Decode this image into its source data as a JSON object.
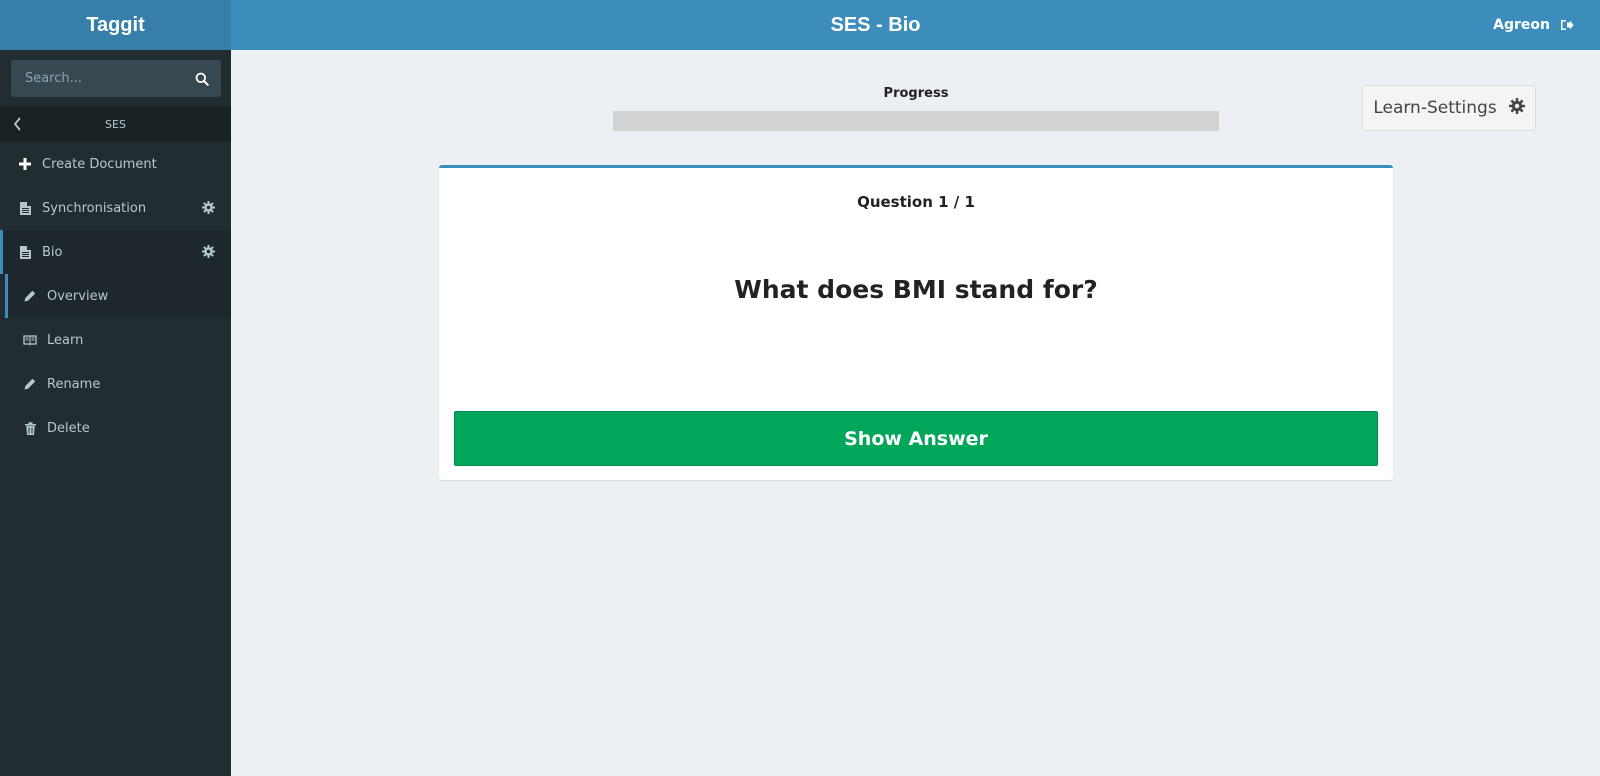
{
  "header": {
    "brand": "Taggit",
    "title": "SES - Bio",
    "user": "Agreon",
    "logout_icon": "sign-out-icon"
  },
  "sidebar": {
    "search_placeholder": "Search...",
    "breadcrumb": "SES",
    "items": [
      {
        "label": "Create Document",
        "icon": "plus-icon"
      },
      {
        "label": "Synchronisation",
        "icon": "document-icon",
        "has_settings": true
      },
      {
        "label": "Bio",
        "icon": "document-icon",
        "has_settings": true,
        "active": true
      }
    ],
    "subitems": [
      {
        "label": "Overview",
        "icon": "pencil-icon",
        "current": true
      },
      {
        "label": "Learn",
        "icon": "book-icon"
      },
      {
        "label": "Rename",
        "icon": "pencil-icon"
      },
      {
        "label": "Delete",
        "icon": "trash-icon"
      }
    ]
  },
  "main": {
    "progress_label": "Progress",
    "progress_value": 0,
    "learn_settings_label": "Learn-Settings",
    "question_counter": "Question 1 / 1",
    "question_text": "What does BMI stand for?",
    "show_answer_label": "Show Answer"
  },
  "colors": {
    "header": "#3c8dbc",
    "brand_bg": "#367fa9",
    "sidebar_bg": "#222d32",
    "content_bg": "#ecf0f5",
    "success": "#00a65a"
  }
}
